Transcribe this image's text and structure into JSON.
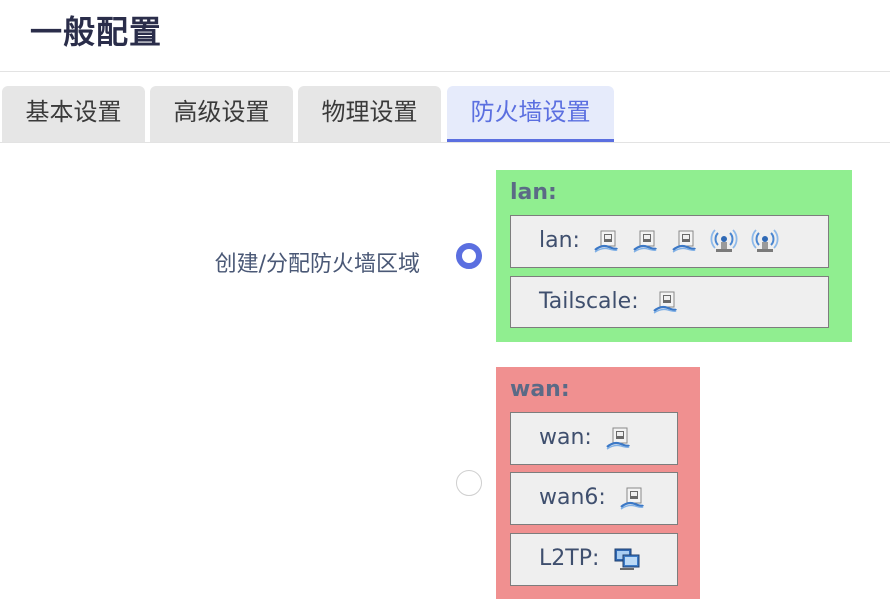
{
  "page": {
    "title": "一般配置"
  },
  "tabs": [
    {
      "label": "基本设置",
      "active": false
    },
    {
      "label": "高级设置",
      "active": false
    },
    {
      "label": "物理设置",
      "active": false
    },
    {
      "label": "防火墙设置",
      "active": true
    }
  ],
  "firewall": {
    "label": "创建/分配防火墙区域",
    "zones": [
      {
        "name": "lan:",
        "color": "#90ee90",
        "selected": true,
        "interfaces": [
          {
            "label": "lan:",
            "icons": [
              "ethernet-port-icon",
              "ethernet-port-icon",
              "ethernet-port-icon",
              "wifi-antenna-icon",
              "wifi-antenna-icon"
            ]
          },
          {
            "label": "Tailscale:",
            "icons": [
              "ethernet-port-icon"
            ]
          }
        ]
      },
      {
        "name": "wan:",
        "color": "#f09090",
        "selected": false,
        "interfaces": [
          {
            "label": "wan:",
            "icons": [
              "ethernet-port-icon"
            ]
          },
          {
            "label": "wan6:",
            "icons": [
              "ethernet-port-icon"
            ]
          },
          {
            "label": "L2TP:",
            "icons": [
              "tunnel-network-icon"
            ]
          }
        ]
      }
    ]
  }
}
